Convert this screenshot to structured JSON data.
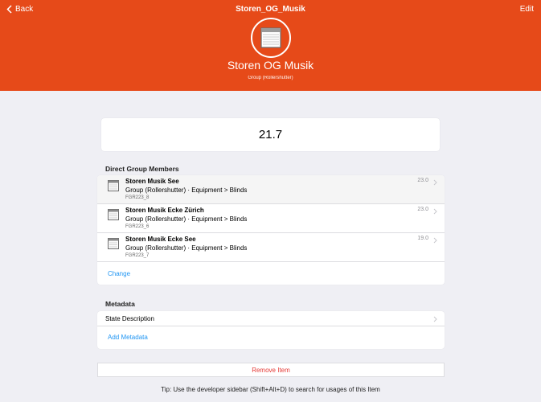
{
  "nav": {
    "back_label": "Back",
    "title": "Storen_OG_Musik",
    "edit_label": "Edit"
  },
  "item": {
    "label": "Storen OG Musik",
    "type": "Group (Rollershutter)",
    "icon": "rollershutter-icon"
  },
  "state": {
    "value": "21.7"
  },
  "members_section": {
    "title": "Direct Group Members",
    "members": [
      {
        "name": "Storen Musik See",
        "description": "Group (Rollershutter) · Equipment > Blinds",
        "uid": "FGR223_8",
        "value": "23.0"
      },
      {
        "name": "Storen Musik Ecke Zürich",
        "description": "Group (Rollershutter) · Equipment > Blinds",
        "uid": "FGR223_6",
        "value": "23.0"
      },
      {
        "name": "Storen Musik Ecke See",
        "description": "Group (Rollershutter) · Equipment > Blinds",
        "uid": "FGR223_7",
        "value": "19.0"
      }
    ],
    "change_label": "Change"
  },
  "metadata_section": {
    "title": "Metadata",
    "rows": [
      {
        "label": "State Description"
      }
    ],
    "add_label": "Add Metadata"
  },
  "remove_label": "Remove Item",
  "tip": "Tip: Use the developer sidebar (Shift+Alt+D) to search for usages of this Item",
  "colors": {
    "accent": "#e64a19",
    "link": "#2196f3",
    "danger": "#e53935"
  }
}
